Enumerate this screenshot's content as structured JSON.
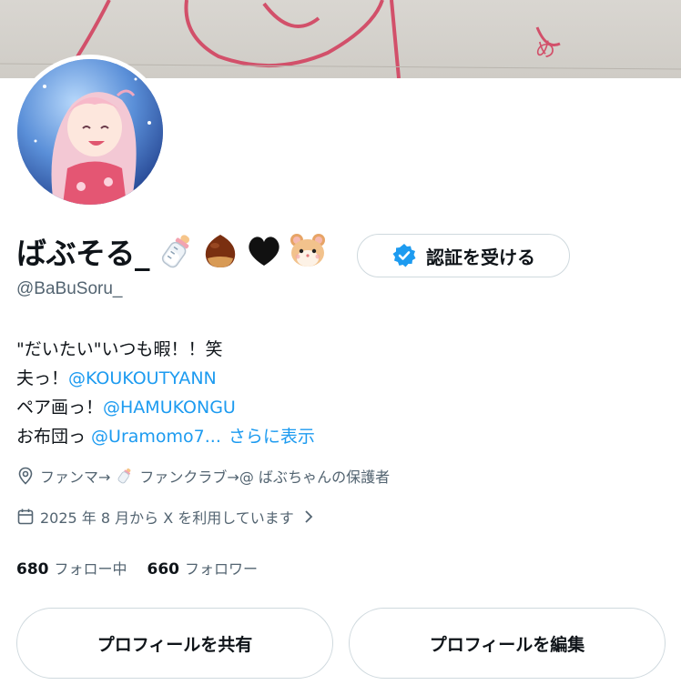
{
  "profile": {
    "display_name": "ばぶそる_",
    "emojis": [
      "baby-bottle-emoji",
      "chestnut-emoji",
      "black-heart-emoji",
      "hamster-emoji"
    ],
    "handle": "@BaBuSoru_",
    "verify_button_label": "認証を受ける",
    "bio": {
      "line1": "\"だいたい\"いつも暇！！笑",
      "line2_prefix": "夫っ！",
      "line2_link": "@KOUKOUTYANN",
      "line3_prefix": "ペア画っ！",
      "line3_link": "@HAMUKONGU",
      "line4_prefix": "お布団っ ",
      "line4_link": "@Uramomo7...",
      "show_more": "さらに表示"
    },
    "location_prefix": "ファンマ→",
    "location_suffix": " ファンクラブ→@ ばぶちゃんの保護者",
    "joined": "2025 年 8 月から X を利用しています",
    "following_count": "680",
    "following_label": "フォロー中",
    "followers_count": "660",
    "followers_label": "フォロワー",
    "share_button": "プロフィールを共有",
    "edit_button": "プロフィールを編集"
  },
  "colors": {
    "link": "#1d9bf0",
    "secondary_text": "#536471",
    "verified_badge": "#1d9bf0",
    "border": "#cfd9de"
  }
}
